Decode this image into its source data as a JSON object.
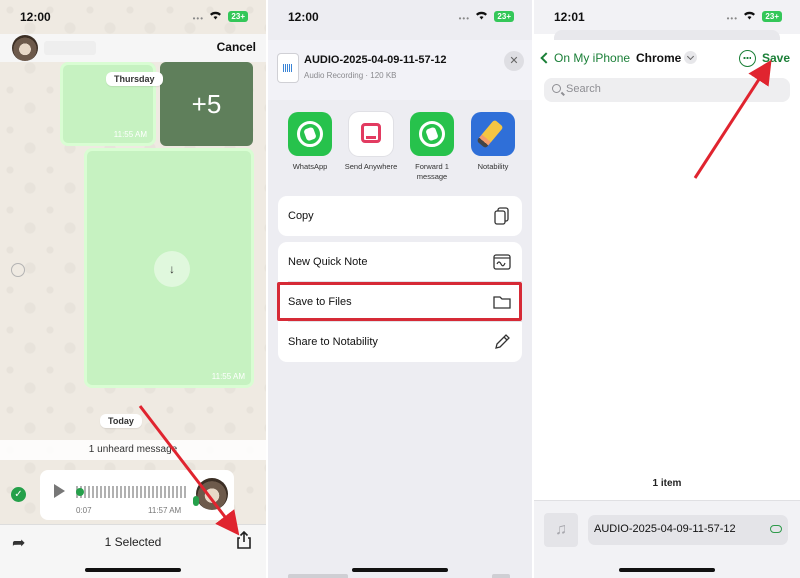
{
  "status": {
    "panel1_time": "12:00",
    "panel2_time": "12:00",
    "panel3_time": "12:01",
    "battery": "23+"
  },
  "chat": {
    "cancel_label": "Cancel",
    "day_thursday": "Thursday",
    "more_images": "+5",
    "img_time_1": "11:55 AM",
    "img_time_2": "11:55 AM",
    "day_today": "Today",
    "unheard": "1 unheard message",
    "voice_duration": "0:07",
    "voice_time": "11:57 AM",
    "selected_label": "1 Selected"
  },
  "share_sheet": {
    "file_title": "AUDIO-2025-04-09-11-57-12",
    "file_subtitle": "Audio Recording · 120 KB",
    "close_icon": "close-icon",
    "apps": [
      {
        "label": "WhatsApp"
      },
      {
        "label": "Send Anywhere"
      },
      {
        "label": "Forward 1 message"
      },
      {
        "label": "Notability"
      }
    ],
    "actions": {
      "copy": "Copy",
      "quick_note": "New Quick Note",
      "save_files": "Save to Files",
      "notability": "Share to Notability"
    }
  },
  "files": {
    "back_label": "On My iPhone",
    "folder": "Chrome",
    "save_label": "Save",
    "search_placeholder": "Search",
    "item_count": "1 item",
    "file_name": "AUDIO-2025-04-09-11-57-12"
  },
  "colors": {
    "whatsapp_green": "#27c24c",
    "files_accent": "#1a7f37",
    "highlight_red": "#d62a36"
  }
}
